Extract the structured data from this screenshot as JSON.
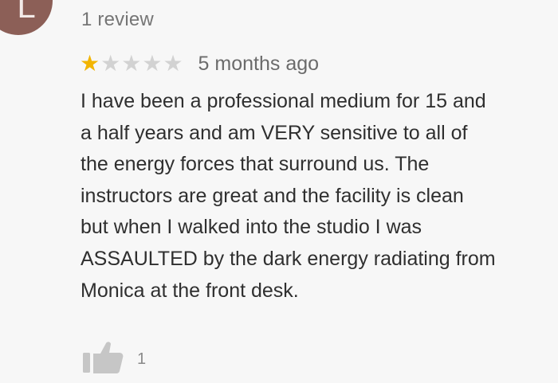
{
  "reviewer": {
    "avatar_letter": "L",
    "review_count": "1 review"
  },
  "rating": {
    "value": 1,
    "max": 5,
    "star_filled_color": "#f2b400",
    "star_empty_color": "#d2d2d2",
    "timestamp": "5 months ago"
  },
  "review": {
    "lines": [
      "I have been a professional medium for 15 and",
      "a half years and am VERY sensitive to all of",
      "the energy forces that surround us. The",
      "instructors are great and the facility is clean",
      "but when I walked into the studio I was",
      "ASSAULTED by the dark energy radiating from",
      "Monica at the front desk."
    ]
  },
  "actions": {
    "helpful_icon": "thumbs-up-icon",
    "helpful_count": "1"
  }
}
